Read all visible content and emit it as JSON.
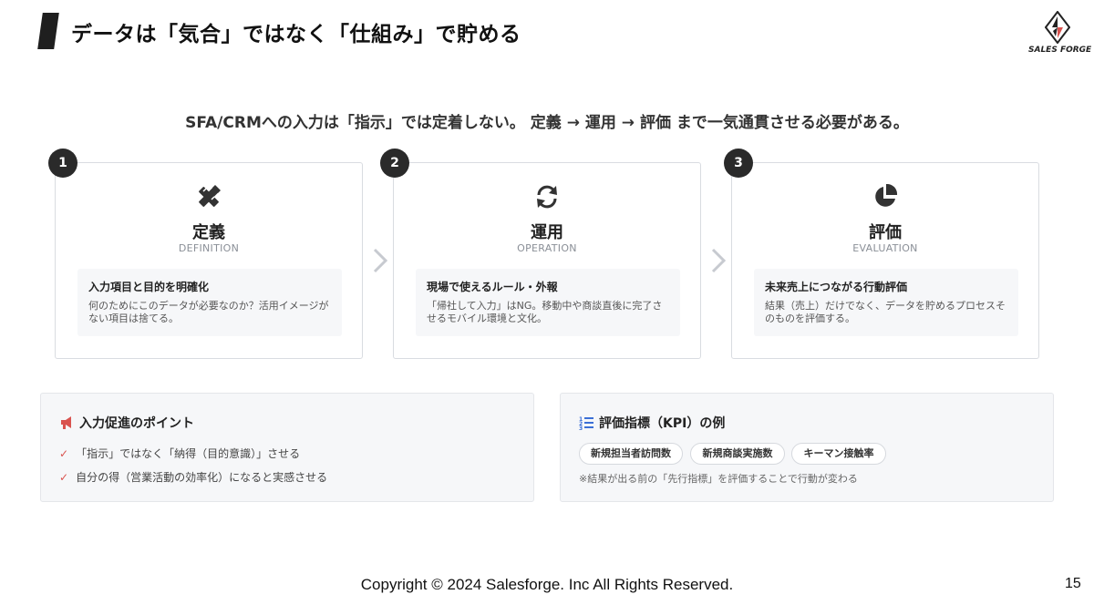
{
  "header": {
    "title": "データは「気合」ではなく「仕組み」で貯める"
  },
  "logo": {
    "text": "SALES FORGE"
  },
  "subtitle": "SFA/CRMへの入力は「指示」では定着しない。 定義 → 運用 → 評価 まで一気通貫させる必要がある。",
  "steps": [
    {
      "num": "1",
      "icon": "pencil-ruler-icon",
      "name": "定義",
      "en": "DEFINITION",
      "box_title": "入力項目と目的を明確化",
      "box_desc": "何のためにこのデータが必要なのか？活用イメージがない項目は捨てる。"
    },
    {
      "num": "2",
      "icon": "sync-icon",
      "name": "運用",
      "en": "OPERATION",
      "box_title": "現場で使えるルール・外報",
      "box_desc": "「帰社して入力」はNG。移動中や商談直後に完了させるモバイル環境と文化。"
    },
    {
      "num": "3",
      "icon": "pie-chart-icon",
      "name": "評価",
      "en": "EVALUATION",
      "box_title": "未来売上につながる行動評価",
      "box_desc": "結果（売上）だけでなく、データを貯めるプロセスそのものを評価する。"
    }
  ],
  "promo": {
    "icon": "megaphone-icon",
    "title": "入力促進のポイント",
    "items": [
      "「指示」ではなく「納得（目的意識）」させる",
      "自分の得（営業活動の効率化）になると実感させる"
    ]
  },
  "kpi": {
    "icon": "numbered-list-icon",
    "title": "評価指標（KPI）の例",
    "pills": [
      "新規担当者訪問数",
      "新規商談実施数",
      "キーマン接触率"
    ],
    "note": "※結果が出る前の「先行指標」を評価することで行動が変わる"
  },
  "footer": {
    "copyright": "Copyright © 2024 Salesforge. Inc All Rights Reserved.",
    "page": "15"
  },
  "colors": {
    "accent": "#d9534f",
    "badge": "#2a2a2a",
    "kpi_icon": "#3b6fd6",
    "panel_bg": "#f6f7f9"
  }
}
